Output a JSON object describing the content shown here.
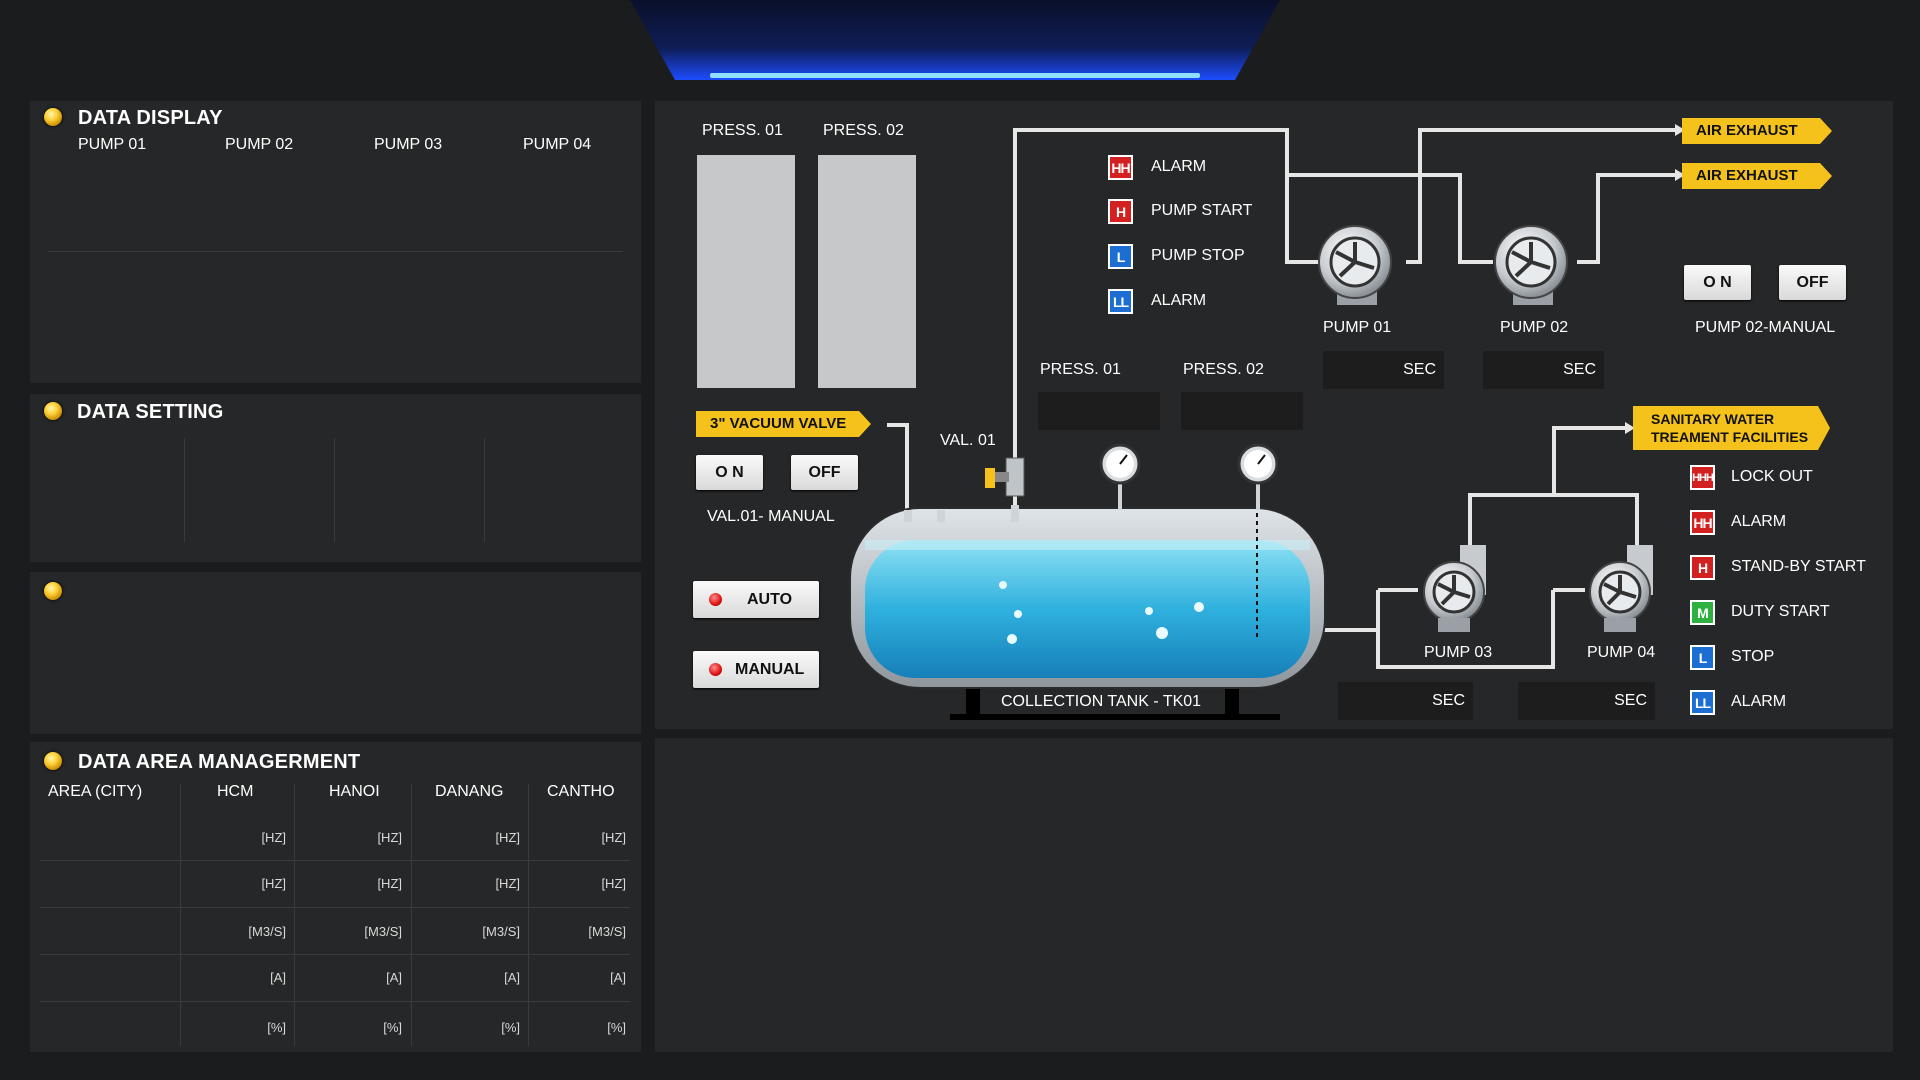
{
  "data_display": {
    "title": "DATA DISPLAY",
    "columns": [
      "PUMP 01",
      "PUMP 02",
      "PUMP 03",
      "PUMP 04"
    ]
  },
  "data_setting": {
    "title": "DATA SETTING"
  },
  "area_mgmt": {
    "title": "DATA AREA MANAGERMENT",
    "header": [
      "AREA (CITY)",
      "HCM",
      "HANOI",
      "DANANG",
      "CANTHO"
    ],
    "row_units": [
      "[HZ]",
      "[HZ]",
      "[M3/S]",
      "[A]",
      "[%]"
    ]
  },
  "pressure_bars": {
    "labels": [
      "PRESS. 01",
      "PRESS. 02"
    ]
  },
  "vacuum_valve": {
    "tag": "3\" VACUUM VALVE",
    "on_label": "O N",
    "off_label": "OFF",
    "manual_label": "VAL.01- MANUAL"
  },
  "mode": {
    "auto_label": "AUTO",
    "manual_label": "MANUAL"
  },
  "tank": {
    "valve_label": "VAL. 01",
    "press_labels": [
      "PRESS. 01",
      "PRESS. 02"
    ],
    "name": "COLLECTION TANK - TK01"
  },
  "legend_top": [
    {
      "code": "HH",
      "color": "#d32020",
      "label": "ALARM"
    },
    {
      "code": "H",
      "color": "#d32020",
      "label": "PUMP START"
    },
    {
      "code": "L",
      "color": "#1c6ed3",
      "label": "PUMP STOP"
    },
    {
      "code": "LL",
      "color": "#1c6ed3",
      "label": "ALARM"
    }
  ],
  "exhaust": {
    "labels": [
      "AIR EXHAUST",
      "AIR EXHAUST"
    ]
  },
  "pumps_top": {
    "names": [
      "PUMP 01",
      "PUMP 02"
    ],
    "sec": [
      "SEC",
      "SEC"
    ]
  },
  "pump02_manual": {
    "on_label": "O N",
    "off_label": "OFF",
    "label": "PUMP 02-MANUAL"
  },
  "sanitary": {
    "line1": "SANITARY WATER",
    "line2": "TREAMENT FACILITIES"
  },
  "pumps_bottom": {
    "names": [
      "PUMP 03",
      "PUMP 04"
    ],
    "sec": [
      "SEC",
      "SEC"
    ]
  },
  "legend_bottom": [
    {
      "code": "HHH",
      "color": "#d32020",
      "label": "LOCK OUT"
    },
    {
      "code": "HH",
      "color": "#d32020",
      "label": "ALARM"
    },
    {
      "code": "H",
      "color": "#d32020",
      "label": "STAND-BY START"
    },
    {
      "code": "M",
      "color": "#2eb13e",
      "label": "DUTY START"
    },
    {
      "code": "L",
      "color": "#1c6ed3",
      "label": "STOP"
    },
    {
      "code": "LL",
      "color": "#1c6ed3",
      "label": "ALARM"
    }
  ]
}
